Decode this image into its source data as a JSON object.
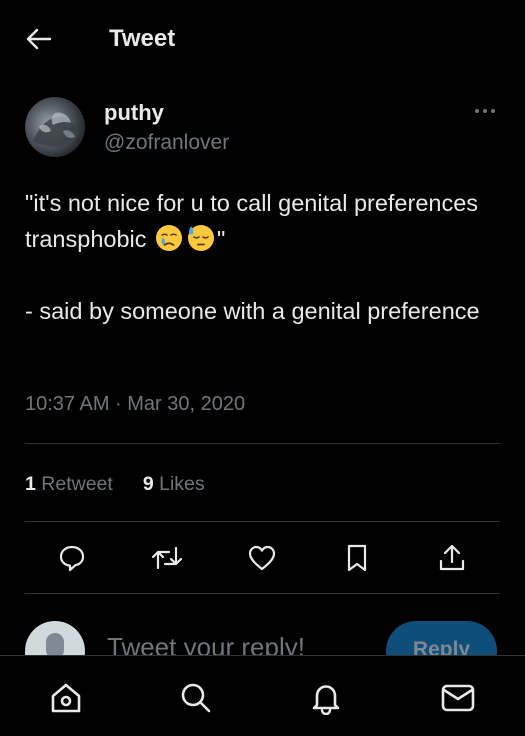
{
  "header": {
    "title": "Tweet",
    "back_icon": "arrow-left-icon"
  },
  "tweet": {
    "author": {
      "display_name": "puthy",
      "handle": "@zofranlover"
    },
    "text": {
      "line1_prefix": "\"it's not nice for u to call genital preferences transphobic",
      "emojis": [
        "crying-face-emoji",
        "downcast-face-with-sweat-emoji"
      ],
      "line1_suffix": "\"",
      "line2": "- said by someone with a genital preference"
    },
    "timestamp": "10:37 AM · Mar 30, 2020",
    "stats": {
      "retweets_count": "1",
      "retweets_label": "Retweet",
      "likes_count": "9",
      "likes_label": "Likes"
    },
    "actions": [
      "reply-icon",
      "retweet-icon",
      "like-icon",
      "bookmark-icon",
      "share-icon"
    ]
  },
  "reply": {
    "placeholder": "Tweet your reply!",
    "button_label": "Reply"
  },
  "bottom_nav": [
    "home-icon",
    "search-icon",
    "notifications-icon",
    "messages-icon"
  ],
  "colors": {
    "background": "#000000",
    "text_primary": "#e7e9ea",
    "text_secondary": "#71767b",
    "divider": "#2f3336",
    "reply_button": "#0f4e78"
  }
}
